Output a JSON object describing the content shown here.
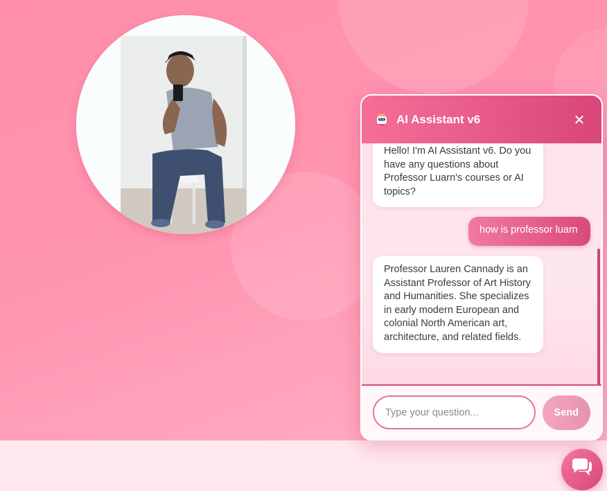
{
  "chat": {
    "title": "AI Assistant v6",
    "close_label": "✕",
    "messages": [
      {
        "role": "bot",
        "text": "Hello! I'm AI Assistant v6. Do you have any questions about Professor Luarn's courses or AI topics?"
      },
      {
        "role": "user",
        "text": "how is professor luarn"
      },
      {
        "role": "bot",
        "text": "Professor Lauren Cannady is an Assistant Professor of Art History and Humanities. She specializes in early modern European and colonial North American art, architecture, and related fields."
      }
    ],
    "input": {
      "placeholder": "Type your question...",
      "value": ""
    },
    "send_label": "Send"
  },
  "icons": {
    "bot": "robot-icon",
    "close": "close-icon",
    "launcher": "chat-bubbles-icon"
  },
  "colors": {
    "accent": "#d9467a",
    "hero_bg": "#ff94b0",
    "footer_bg": "#ffe9ef"
  }
}
